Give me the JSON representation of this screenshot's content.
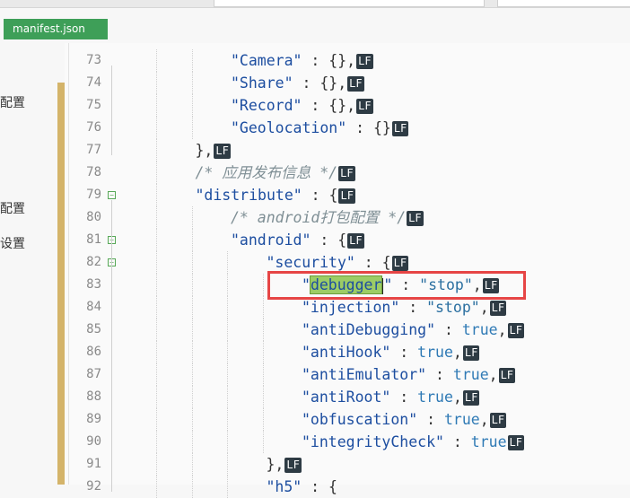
{
  "tab": {
    "label": "manifest.json"
  },
  "sidebar": {
    "labels": [
      "配置",
      "配置",
      "设置"
    ]
  },
  "editor": {
    "lines": [
      {
        "num": "73",
        "code": "\"Camera\" : {},",
        "lf": "LF",
        "indent": 3
      },
      {
        "num": "74",
        "code": "\"Share\" : {},",
        "lf": "LF",
        "indent": 3
      },
      {
        "num": "75",
        "code": "\"Record\" : {},",
        "lf": "LF",
        "indent": 3
      },
      {
        "num": "76",
        "code": "\"Geolocation\" : {}",
        "lf": "LF",
        "indent": 3
      },
      {
        "num": "77",
        "code": "},",
        "lf": "LF",
        "indent": 2
      },
      {
        "num": "78",
        "code": "/* 应用发布信息 */",
        "lf": "LF",
        "indent": 2
      },
      {
        "num": "79",
        "code": "\"distribute\" : {",
        "lf": "LF",
        "indent": 2
      },
      {
        "num": "80",
        "code": "/* android打包配置 */",
        "lf": "LF",
        "indent": 3
      },
      {
        "num": "81",
        "code": "\"android\" : {",
        "lf": "LF",
        "indent": 3
      },
      {
        "num": "82",
        "code": "\"security\" : {",
        "lf": "LF",
        "indent": 4
      },
      {
        "num": "83",
        "code": "\"debugger\" : \"stop\",",
        "lf": "LF",
        "indent": 5
      },
      {
        "num": "84",
        "code": "\"injection\" : \"stop\",",
        "lf": "LF",
        "indent": 5
      },
      {
        "num": "85",
        "code": "\"antiDebugging\" : true,",
        "lf": "LF",
        "indent": 5
      },
      {
        "num": "86",
        "code": "\"antiHook\" : true,",
        "lf": "LF",
        "indent": 5
      },
      {
        "num": "87",
        "code": "\"antiEmulator\" : true,",
        "lf": "LF",
        "indent": 5
      },
      {
        "num": "88",
        "code": "\"antiRoot\" : true,",
        "lf": "LF",
        "indent": 5
      },
      {
        "num": "89",
        "code": "\"obfuscation\" : true,",
        "lf": "LF",
        "indent": 5
      },
      {
        "num": "90",
        "code": "\"integrityCheck\" : true",
        "lf": "LF",
        "indent": 5
      },
      {
        "num": "91",
        "code": "},",
        "lf": "LF",
        "indent": 4
      },
      {
        "num": "92",
        "code": "\"h5\" : {",
        "lf": "",
        "indent": 4
      }
    ],
    "foldable": [
      "79",
      "81",
      "82"
    ],
    "highlight": {
      "line": "83",
      "word": "debugger"
    }
  }
}
